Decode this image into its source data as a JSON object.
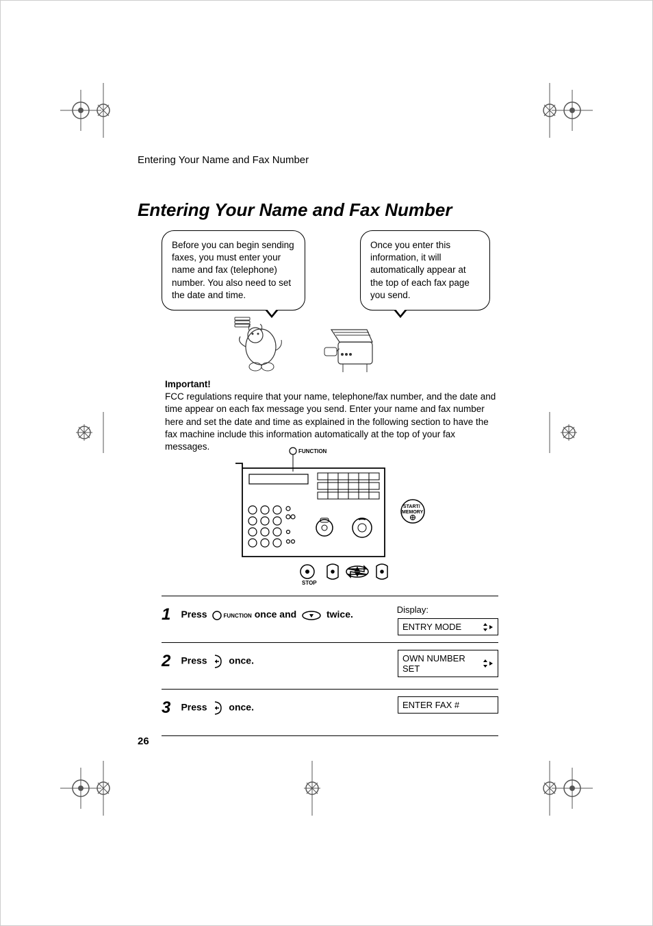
{
  "header": "Entering Your Name and Fax Number",
  "title": "Entering Your Name and Fax Number",
  "bubbles": {
    "left": "Before you can begin sending faxes, you must enter your name and fax (telephone) number. You also need to set the date and time.",
    "right": "Once you enter this information, it will automatically appear at the top of each fax page you send."
  },
  "important": {
    "label": "Important!",
    "text": "FCC regulations require that your name, telephone/fax number, and the date and time appear on each fax message you send. Enter your name and fax number here and set the date and time as explained in the following section to have the fax machine include this information automatically at the top of your fax messages."
  },
  "panel": {
    "function_label": "FUNCTION",
    "stop_label": "STOP",
    "start_memory_label_line1": "START/",
    "start_memory_label_line2": "MEMORY"
  },
  "steps": [
    {
      "num": "1",
      "prefix": "Press ",
      "mid": " once and ",
      "suffix": " twice.",
      "func_label": "FUNCTION",
      "display_label": "Display:",
      "display": "ENTRY MODE"
    },
    {
      "num": "2",
      "prefix": "Press ",
      "suffix": " once.",
      "display": "OWN NUMBER SET"
    },
    {
      "num": "3",
      "prefix": "Press ",
      "suffix": " once.",
      "display": "ENTER FAX #"
    }
  ],
  "page_number": "26"
}
